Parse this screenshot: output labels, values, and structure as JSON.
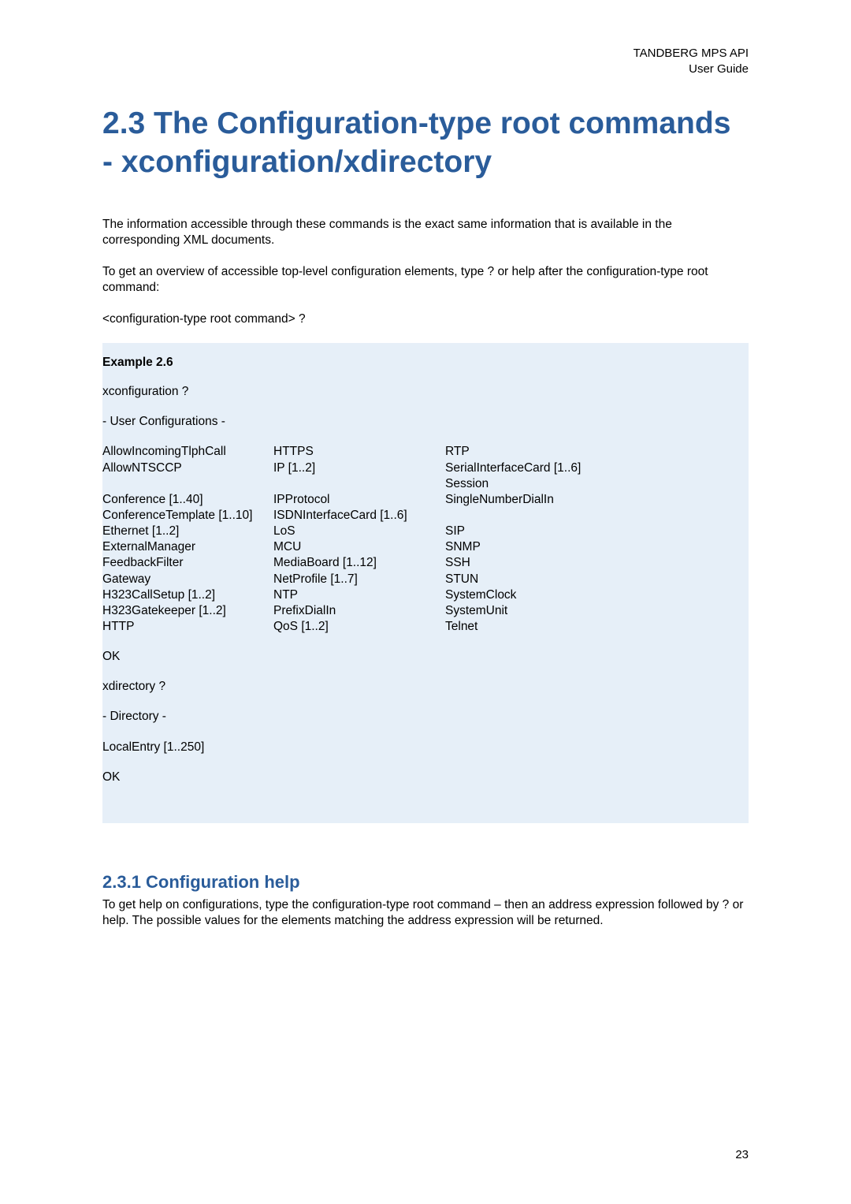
{
  "header": {
    "line1": "TANDBERG MPS API",
    "line2": "User Guide"
  },
  "title": "2.3 The Configuration-type root commands - xconfiguration/xdirectory",
  "intro1": "The information accessible through these commands is the exact same information that is available in the corresponding XML documents.",
  "intro2": "To get an overview of accessible top-level configuration elements, type ? or help after the configuration-type root command:",
  "intro3": "<configuration-type root command> ?",
  "example": {
    "label": "Example 2.6",
    "cmd1": "xconfiguration ?",
    "sub1": " - User Configurations -",
    "columns": {
      "c1": [
        "AllowIncomingTlphCall",
        "AllowNTSCCP",
        "",
        "Conference [1..40]",
        "ConferenceTemplate [1..10]",
        "Ethernet [1..2]",
        "ExternalManager",
        "FeedbackFilter",
        "Gateway",
        "H323CallSetup [1..2]",
        "H323Gatekeeper [1..2]",
        "HTTP"
      ],
      "c2": [
        "HTTPS",
        "IP [1..2]",
        "",
        "IPProtocol",
        "ISDNInterfaceCard [1..6]",
        "LoS",
        "MCU",
        "MediaBoard [1..12]",
        "NetProfile [1..7]",
        "NTP",
        "PrefixDialIn",
        "QoS [1..2]"
      ],
      "c3": [
        "RTP",
        "SerialInterfaceCard [1..6]",
        "Session",
        "SingleNumberDialIn",
        "",
        "SIP",
        "SNMP",
        "SSH",
        "STUN",
        "SystemClock",
        "SystemUnit",
        "Telnet"
      ]
    },
    "ok1": "OK",
    "cmd2": "xdirectory ?",
    "sub2": " - Directory -",
    "entry": "LocalEntry [1..250]",
    "ok2": "OK"
  },
  "subsection": {
    "title": "2.3.1 Configuration help",
    "body": "To get help on configurations, type the configuration-type root command – then an address expression followed by ? or help. The possible values for the elements matching the address expression will be returned."
  },
  "pageNumber": "23"
}
